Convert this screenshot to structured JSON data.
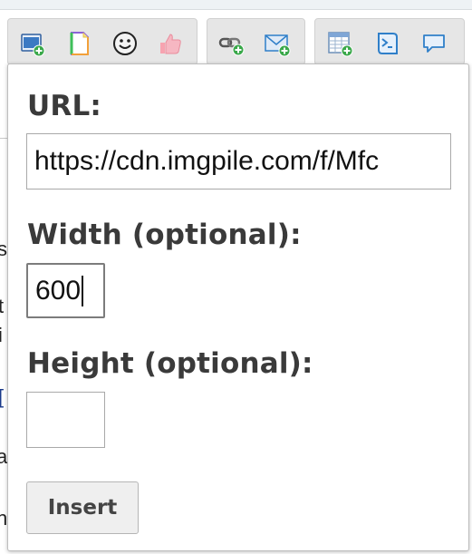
{
  "toolbar": {
    "groups": [
      {
        "buttons": [
          "image-icon",
          "page-icon",
          "smiley-icon",
          "thumbs-up-icon"
        ]
      },
      {
        "buttons": [
          "link-icon",
          "email-icon"
        ]
      },
      {
        "buttons": [
          "table-icon",
          "code-icon",
          "comment-icon"
        ]
      }
    ]
  },
  "background": {
    "letters": [
      "s",
      "t",
      "i",
      "[",
      "a",
      "n"
    ]
  },
  "dialog": {
    "url_label": "URL:",
    "url_value": "https://cdn.imgpile.com/f/Mfc",
    "width_label": "Width (optional):",
    "width_value": "600",
    "height_label": "Height (optional):",
    "height_value": "",
    "insert_label": "Insert"
  },
  "colors": {
    "icon_green": "#3aa84a",
    "icon_blue": "#2f7fc9",
    "label_text": "#3a3a3a",
    "toolbar_bg": "#e6e6e6"
  }
}
